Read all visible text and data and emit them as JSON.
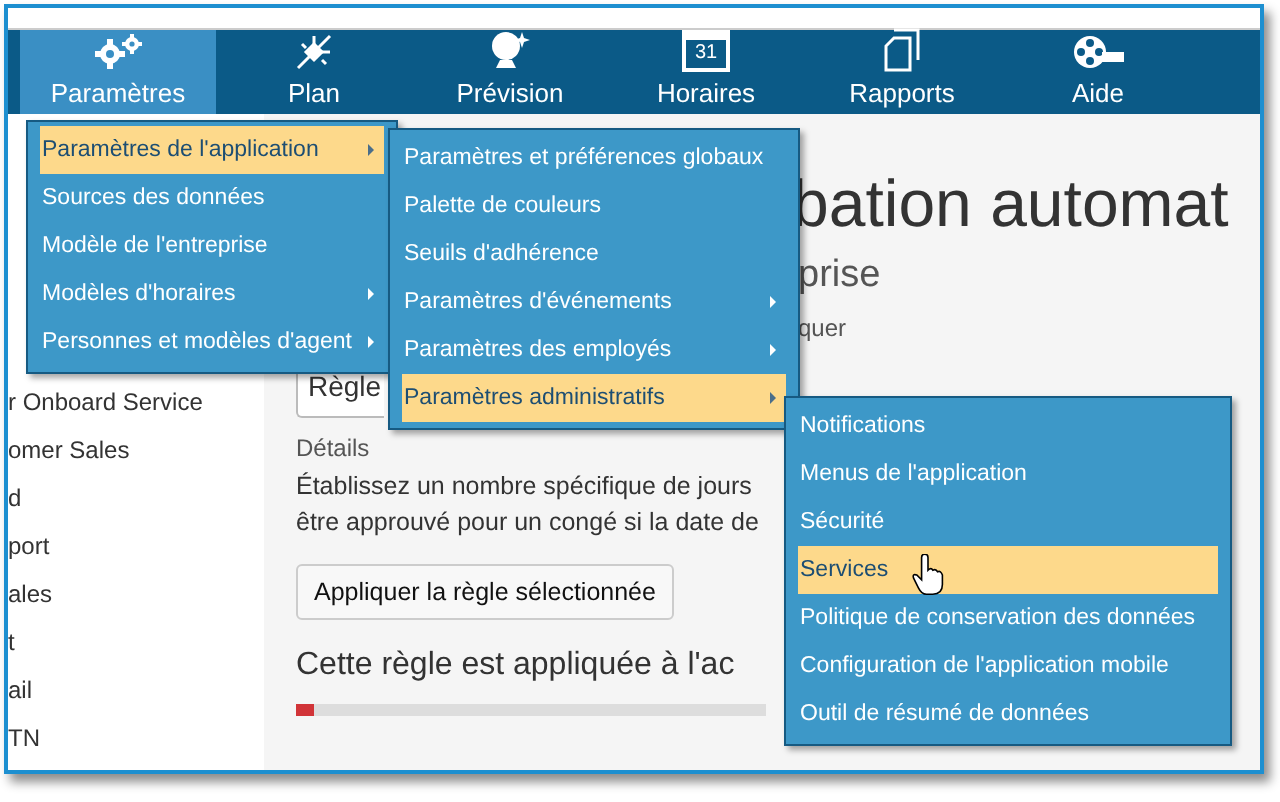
{
  "nav": [
    {
      "label": "Paramètres",
      "selected": true
    },
    {
      "label": "Plan",
      "selected": false
    },
    {
      "label": "Prévision",
      "selected": false
    },
    {
      "label": "Horaires",
      "icon_text": "31",
      "selected": false
    },
    {
      "label": "Rapports",
      "selected": false
    },
    {
      "label": "Aide",
      "selected": false
    }
  ],
  "sidebar": {
    "items": [
      "r Onboard Service",
      "omer Sales",
      "d",
      "port",
      "ales",
      "t",
      "ail",
      "TN"
    ]
  },
  "content": {
    "title": "bation automat",
    "subtitle": "prise",
    "select_label": "quer",
    "select": {
      "value": "Règle"
    },
    "details_label": "Détails",
    "details": [
      "Établissez un nombre spécifique de jours",
      "être approuvé pour un congé si la date de"
    ],
    "apply_button": "Appliquer la règle sélectionnée",
    "section_heading": "Cette règle est appliquée à l'ac",
    "progress": {
      "level": 0.04
    }
  },
  "menus": [
    {
      "items": [
        {
          "label": "Paramètres de l'application",
          "has_submenu": true,
          "selected": true
        },
        {
          "label": "Sources des données",
          "has_submenu": false,
          "selected": false
        },
        {
          "label": "Modèle de l'entreprise",
          "has_submenu": false,
          "selected": false
        },
        {
          "label": "Modèles d'horaires",
          "has_submenu": true,
          "selected": false
        },
        {
          "label": "Personnes et modèles d'agent",
          "has_submenu": true,
          "selected": false
        }
      ]
    },
    {
      "items": [
        {
          "label": "Paramètres et préférences globaux",
          "has_submenu": false,
          "selected": false
        },
        {
          "label": "Palette de couleurs",
          "has_submenu": false,
          "selected": false
        },
        {
          "label": "Seuils d'adhérence",
          "has_submenu": false,
          "selected": false
        },
        {
          "label": "Paramètres d'événements",
          "has_submenu": true,
          "selected": false
        },
        {
          "label": "Paramètres des employés",
          "has_submenu": true,
          "selected": false
        },
        {
          "label": "Paramètres administratifs",
          "has_submenu": true,
          "selected": true
        }
      ]
    },
    {
      "items": [
        {
          "label": "Notifications",
          "has_submenu": false,
          "selected": false
        },
        {
          "label": "Menus de l'application",
          "has_submenu": false,
          "selected": false
        },
        {
          "label": "Sécurité",
          "has_submenu": false,
          "selected": false
        },
        {
          "label": "Services",
          "has_submenu": false,
          "selected": true
        },
        {
          "label": "Politique de conservation des données",
          "has_submenu": false,
          "selected": false
        },
        {
          "label": "Configuration de l'application mobile",
          "has_submenu": false,
          "selected": false
        },
        {
          "label": "Outil de résumé de données",
          "has_submenu": false,
          "selected": false
        }
      ]
    }
  ]
}
